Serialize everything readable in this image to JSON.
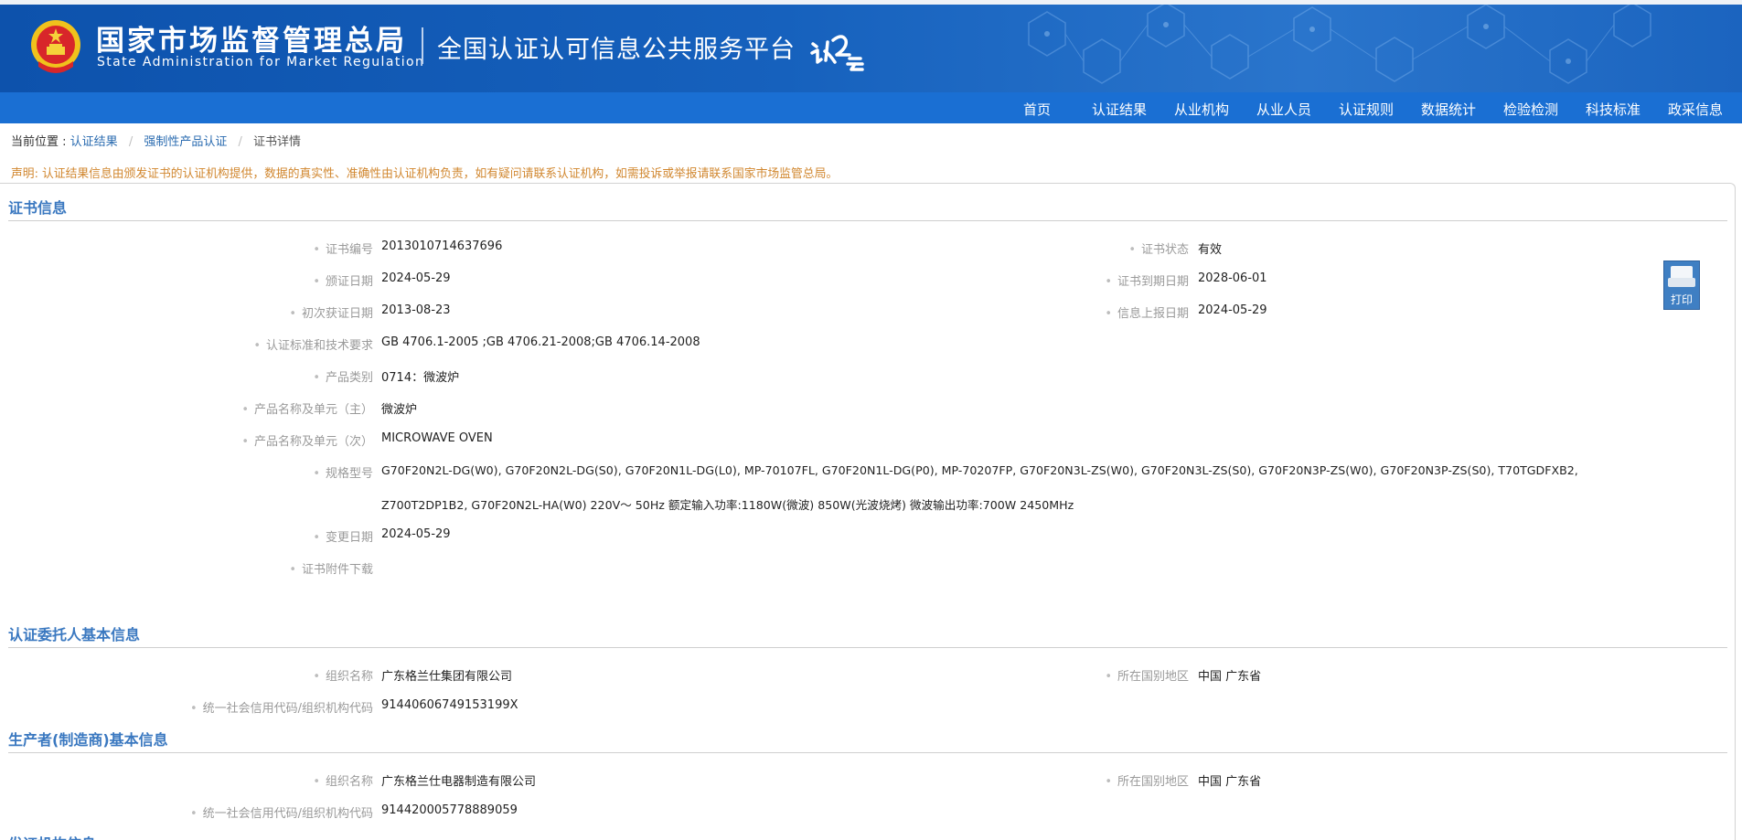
{
  "header": {
    "org_cn": "国家市场监督管理总局",
    "org_en": "State Administration  for  Market Regulation",
    "platform_title": "全国认证认可信息公共服务平台",
    "brand_colors": {
      "banner": "#1661bd",
      "nav": "#1a6fd3",
      "section_title": "#3a78c0",
      "notice": "#d1872f"
    }
  },
  "nav": {
    "items": [
      {
        "label": "首页"
      },
      {
        "label": "认证结果"
      },
      {
        "label": "从业机构"
      },
      {
        "label": "从业人员"
      },
      {
        "label": "认证规则"
      },
      {
        "label": "数据统计"
      },
      {
        "label": "检验检测"
      },
      {
        "label": "科技标准"
      },
      {
        "label": "政采信息"
      }
    ]
  },
  "breadcrumb": {
    "prefix": "当前位置 :",
    "items": [
      "认证结果",
      "强制性产品认证",
      "证书详情"
    ]
  },
  "notice": "声明: 认证结果信息由颁发证书的认证机构提供，数据的真实性、准确性由认证机构负责，如有疑问请联系认证机构，如需投诉或举报请联系国家市场监管总局。",
  "print_label": "打印",
  "cert_info": {
    "title": "证书信息",
    "cert_no_label": "证书编号",
    "cert_no": "2013010714637696",
    "status_label": "证书状态",
    "status": "有效",
    "issue_date_label": "颁证日期",
    "issue_date": "2024-05-29",
    "expiry_label": "证书到期日期",
    "expiry": "2028-06-01",
    "first_date_label": "初次获证日期",
    "first_date": "2013-08-23",
    "report_date_label": "信息上报日期",
    "report_date": "2024-05-29",
    "standards_label": "认证标准和技术要求",
    "standards": "GB 4706.1-2005 ;GB 4706.21-2008;GB 4706.14-2008",
    "category_label": "产品类别",
    "category": "0714：微波炉",
    "name_main_label": "产品名称及单元（主）",
    "name_main": "微波炉",
    "name_sub_label": "产品名称及单元（次）",
    "name_sub": "MICROWAVE OVEN",
    "model_label": "规格型号",
    "model_line1": "G70F20N2L-DG(W0), G70F20N2L-DG(S0), G70F20N1L-DG(L0), MP-70107FL, G70F20N1L-DG(P0), MP-70207FP, G70F20N3L-ZS(W0), G70F20N3L-ZS(S0), G70F20N3P-ZS(W0), G70F20N3P-ZS(S0), T70TGDFXB2,",
    "model_line2": "Z700T2DP1B2, G70F20N2L-HA(W0) 220V～ 50Hz 额定输入功率:1180W(微波) 850W(光波烧烤) 微波输出功率:700W 2450MHz",
    "change_date_label": "变更日期",
    "change_date": "2024-05-29",
    "attachment_label": "证书附件下载"
  },
  "client_info": {
    "title": "认证委托人基本信息",
    "org_name_label": "组织名称",
    "org_name": "广东格兰仕集团有限公司",
    "region_label": "所在国别地区",
    "region": "中国 广东省",
    "credit_code_label": "统一社会信用代码/组织机构代码",
    "credit_code": "91440606749153199X"
  },
  "maker_info": {
    "title": "生产者(制造商)基本信息",
    "org_name_label": "组织名称",
    "org_name": "广东格兰仕电器制造有限公司",
    "region_label": "所在国别地区",
    "region": "中国 广东省",
    "credit_code_label": "统一社会信用代码/组织机构代码",
    "credit_code": "914420005778889059"
  },
  "next_section_title": "发证机构信息"
}
